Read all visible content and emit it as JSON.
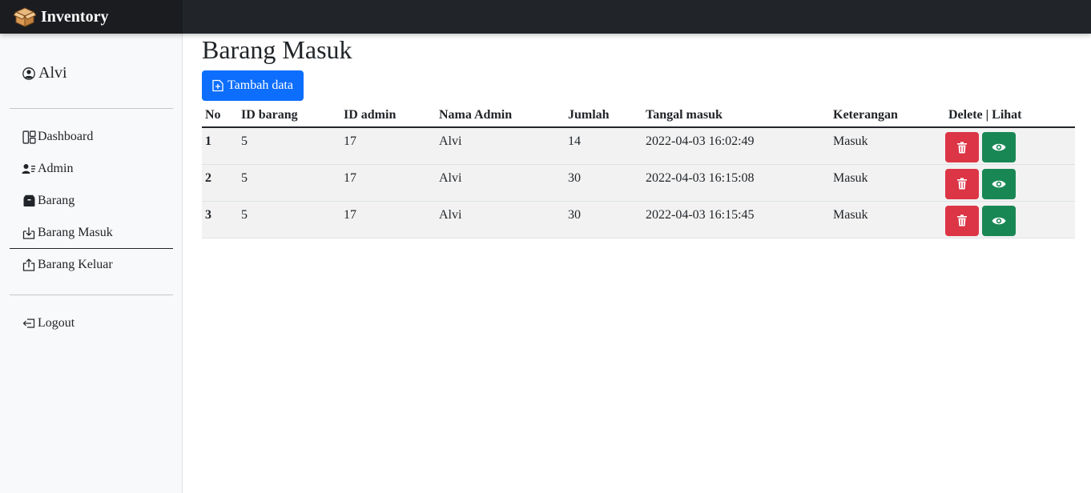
{
  "app": {
    "brand": "Inventory"
  },
  "sidebar": {
    "user": "Alvi",
    "items": [
      {
        "label": "Dashboard",
        "icon": "layout-icon"
      },
      {
        "label": "Admin",
        "icon": "person-lines-icon"
      },
      {
        "label": "Barang",
        "icon": "box-icon"
      },
      {
        "label": "Barang Masuk",
        "icon": "box-arrow-in-icon",
        "active": true
      },
      {
        "label": "Barang Keluar",
        "icon": "box-arrow-out-icon"
      }
    ],
    "logout": "Logout"
  },
  "main": {
    "title": "Barang Masuk",
    "add_button": "Tambah data",
    "table": {
      "headers": [
        "No",
        "ID barang",
        "ID admin",
        "Nama Admin",
        "Jumlah",
        "Tangal masuk",
        "Keterangan",
        "Delete | Lihat"
      ],
      "rows": [
        [
          "1",
          "5",
          "17",
          "Alvi",
          "14",
          "2022-04-03 16:02:49",
          "Masuk"
        ],
        [
          "2",
          "5",
          "17",
          "Alvi",
          "30",
          "2022-04-03 16:15:08",
          "Masuk"
        ],
        [
          "3",
          "5",
          "17",
          "Alvi",
          "30",
          "2022-04-03 16:15:45",
          "Masuk"
        ]
      ]
    }
  },
  "colors": {
    "primary": "#0d6efd",
    "danger": "#dc3545",
    "success": "#198754",
    "dark": "#212529"
  }
}
